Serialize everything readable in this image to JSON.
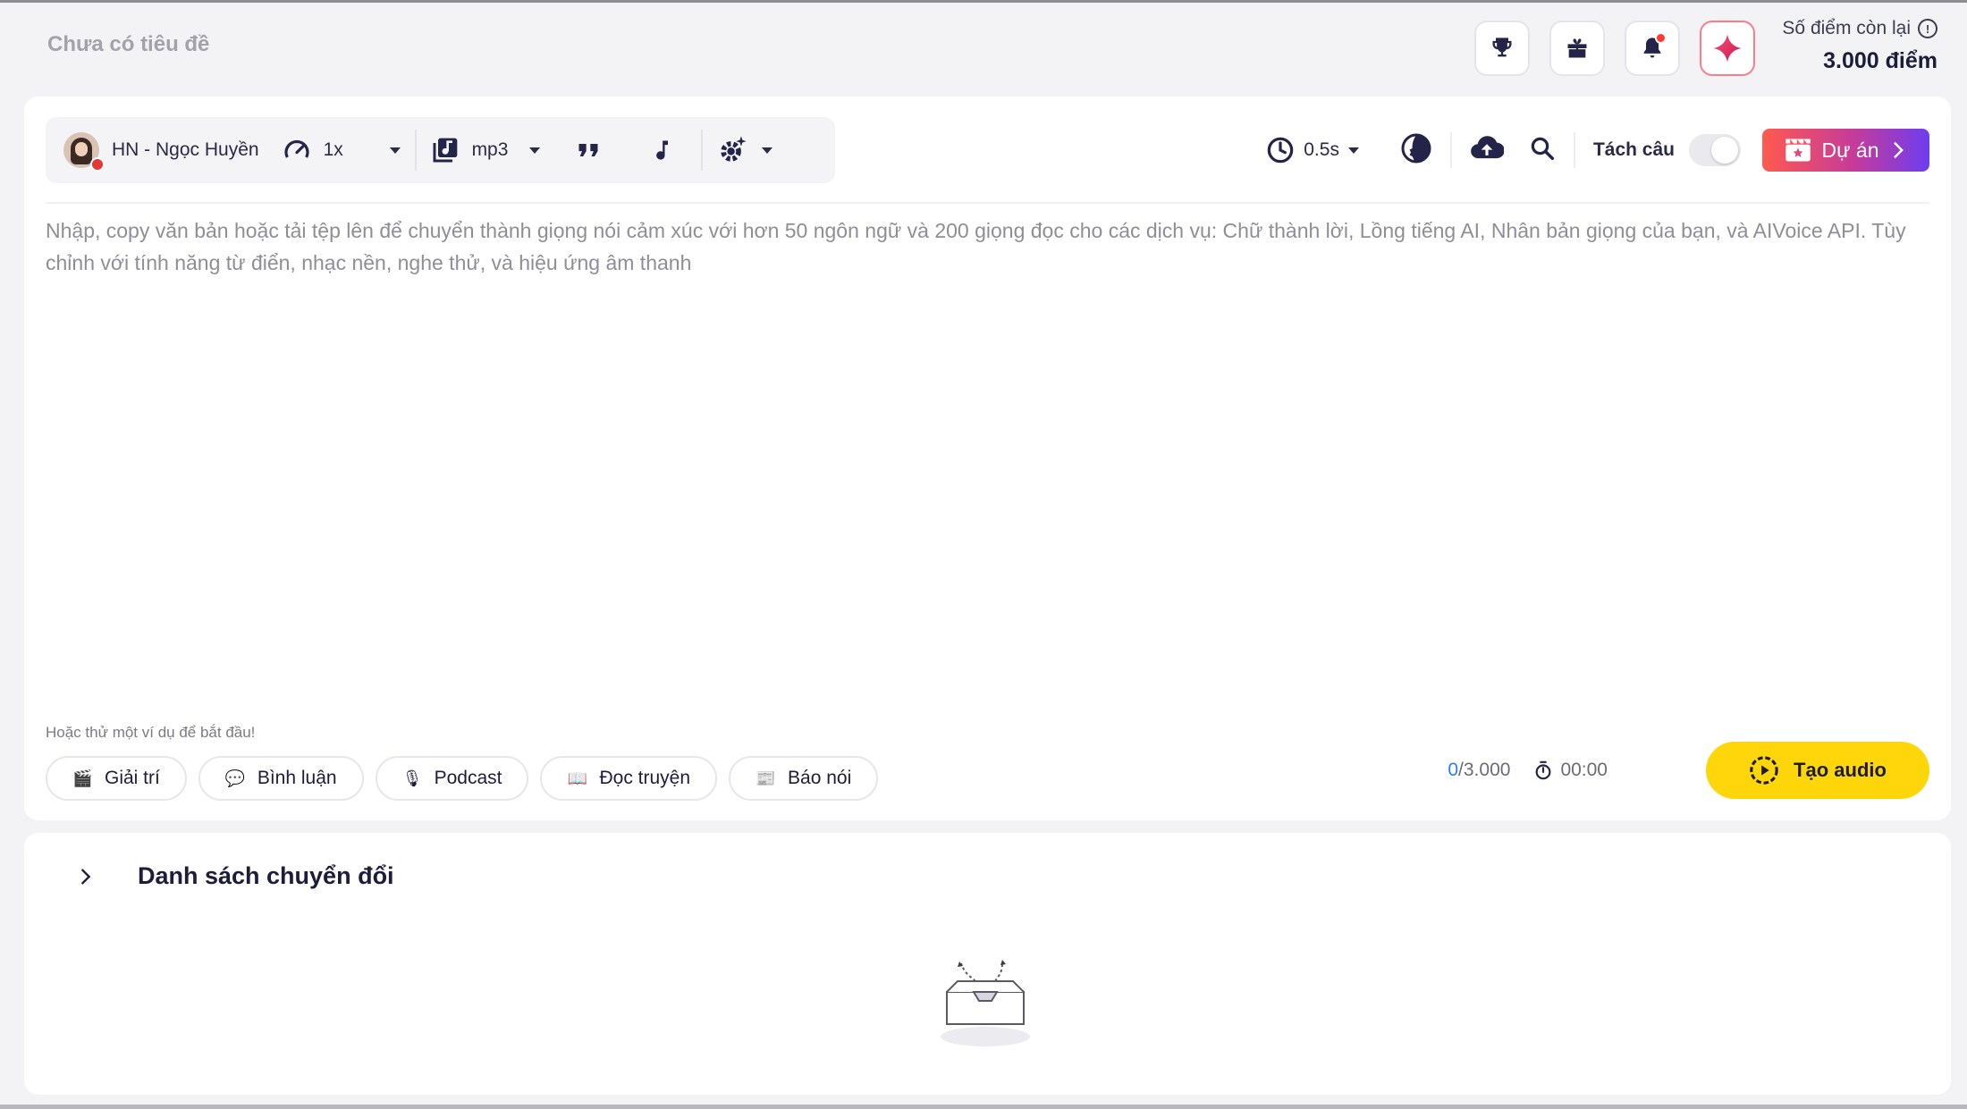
{
  "header": {
    "document_title": "Chưa có tiêu đề",
    "points_label": "Số điểm còn lại",
    "points_value": "3.000 điểm",
    "icons": [
      "trophy-icon",
      "gift-icon",
      "bell-icon",
      "sparkle-icon"
    ]
  },
  "toolbar": {
    "voice_name": "HN - Ngọc Huyền",
    "speed": "1x",
    "format": "mp3",
    "pause": "0.5s",
    "split_sentence_label": "Tách câu",
    "split_sentence_enabled": false,
    "project_button": "Dự án"
  },
  "editor": {
    "placeholder": "Nhập, copy văn bản hoặc tải tệp lên để chuyển thành giọng nói cảm xúc với hơn 50 ngôn ngữ và 200 giọng đọc cho các dịch vụ: Chữ thành lời, Lồng tiếng AI, Nhân bản giọng của bạn, và AIVoice API. Tùy chỉnh với tính năng từ điển, nhạc nền, nghe thử, và hiệu ứng âm thanh"
  },
  "examples": {
    "label": "Hoặc thử một ví dụ để bắt đầu!",
    "chips": [
      {
        "label": "Giải trí",
        "icon": "🎬"
      },
      {
        "label": "Bình luận",
        "icon": "💬"
      },
      {
        "label": "Podcast",
        "icon": "🎙"
      },
      {
        "label": "Đọc truyện",
        "icon": "📖"
      },
      {
        "label": "Báo nói",
        "icon": "📰"
      }
    ]
  },
  "footer": {
    "char_count": "0",
    "char_limit": "/3.000",
    "duration": "00:00",
    "create_button": "Tạo audio"
  },
  "conversion_list": {
    "title": "Danh sách chuyển đổi"
  },
  "colors": {
    "accent_yellow": "#ffd60a",
    "project_gradient_start": "#ff5a4e",
    "project_gradient_end": "#6d3df0",
    "count_blue": "#2d7cf6"
  }
}
